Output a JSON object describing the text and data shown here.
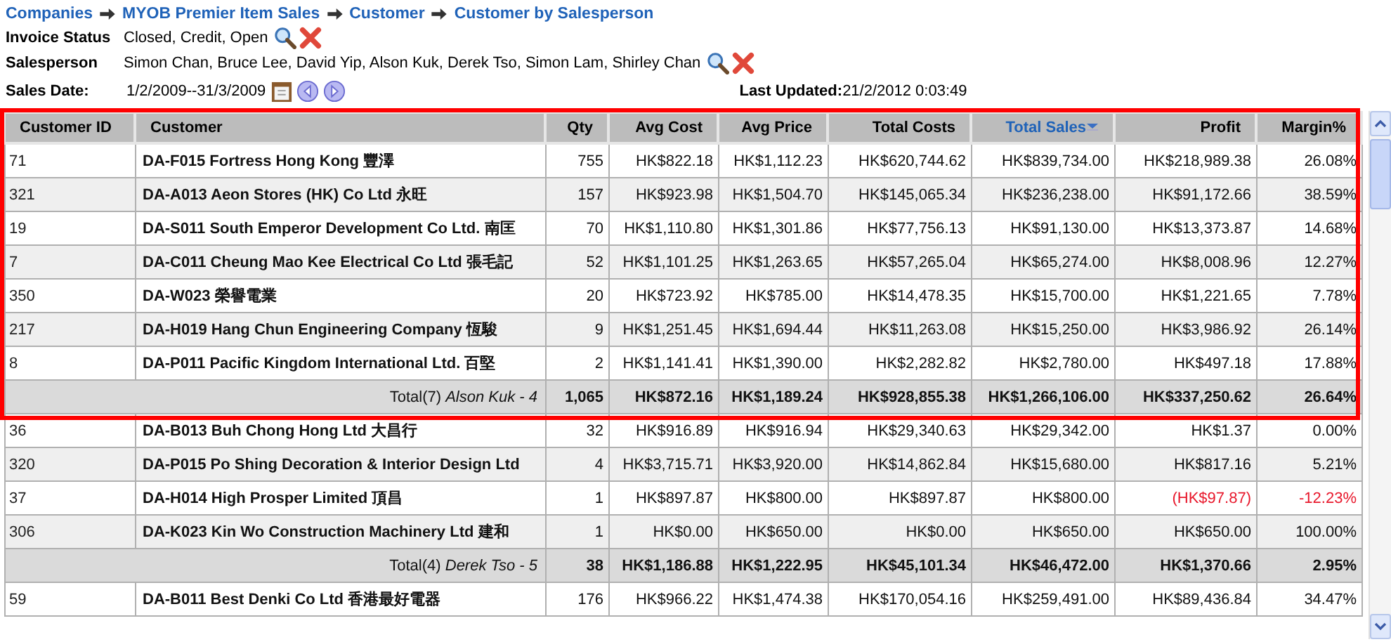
{
  "breadcrumb": [
    "Companies",
    "MYOB Premier Item Sales",
    "Customer",
    "Customer by Salesperson"
  ],
  "filters": [
    {
      "label": "Invoice Status",
      "value": "Closed, Credit, Open"
    },
    {
      "label": "Salesperson",
      "value": "Simon Chan, Bruce Lee, David Yip, Alson Kuk, Derek Tso, Simon Lam, Shirley Chan"
    }
  ],
  "sales_date": {
    "label": "Sales Date:",
    "value": "1/2/2009--31/3/2009"
  },
  "last_updated": {
    "label": "Last Updated:",
    "value": "21/2/2012 0:03:49"
  },
  "table": {
    "columns": [
      {
        "label": "Customer ID",
        "sorted": false
      },
      {
        "label": "Customer",
        "sorted": false
      },
      {
        "label": "Qty",
        "sorted": false
      },
      {
        "label": "Avg Cost",
        "sorted": false
      },
      {
        "label": "Avg Price",
        "sorted": false
      },
      {
        "label": "Total Costs",
        "sorted": false
      },
      {
        "label": "Total Sales",
        "sorted": true
      },
      {
        "label": "Profit",
        "sorted": false
      },
      {
        "label": "Margin%",
        "sorted": false
      }
    ],
    "groups": [
      {
        "highlighted": true,
        "rows": [
          {
            "loss": false,
            "cells": [
              "71",
              "DA-F015 Fortress Hong Kong 豐澤",
              "755",
              "HK$822.18",
              "HK$1,112.23",
              "HK$620,744.62",
              "HK$839,734.00",
              "HK$218,989.38",
              "26.08%"
            ]
          },
          {
            "loss": false,
            "cells": [
              "321",
              "DA-A013 Aeon Stores (HK) Co Ltd 永旺",
              "157",
              "HK$923.98",
              "HK$1,504.70",
              "HK$145,065.34",
              "HK$236,238.00",
              "HK$91,172.66",
              "38.59%"
            ]
          },
          {
            "loss": false,
            "cells": [
              "19",
              "DA-S011 South Emperor Development Co Ltd. 南匡",
              "70",
              "HK$1,110.80",
              "HK$1,301.86",
              "HK$77,756.13",
              "HK$91,130.00",
              "HK$13,373.87",
              "14.68%"
            ]
          },
          {
            "loss": false,
            "cells": [
              "7",
              "DA-C011 Cheung Mao Kee Electrical Co Ltd 張毛記",
              "52",
              "HK$1,101.25",
              "HK$1,263.65",
              "HK$57,265.04",
              "HK$65,274.00",
              "HK$8,008.96",
              "12.27%"
            ]
          },
          {
            "loss": false,
            "cells": [
              "350",
              "DA-W023 榮譽電業",
              "20",
              "HK$723.92",
              "HK$785.00",
              "HK$14,478.35",
              "HK$15,700.00",
              "HK$1,221.65",
              "7.78%"
            ]
          },
          {
            "loss": false,
            "cells": [
              "217",
              "DA-H019 Hang Chun Engineering Company 恆駿",
              "9",
              "HK$1,251.45",
              "HK$1,694.44",
              "HK$11,263.08",
              "HK$15,250.00",
              "HK$3,986.92",
              "26.14%"
            ]
          },
          {
            "loss": false,
            "cells": [
              "8",
              "DA-P011 Pacific Kingdom International Ltd. 百堅",
              "2",
              "HK$1,141.41",
              "HK$1,390.00",
              "HK$2,282.82",
              "HK$2,780.00",
              "HK$497.18",
              "17.88%"
            ]
          }
        ],
        "total": {
          "label": "Total(7) *Alson Kuk - 4*",
          "cells": [
            "1,065",
            "HK$872.16",
            "HK$1,189.24",
            "HK$928,855.38",
            "HK$1,266,106.00",
            "HK$337,250.62",
            "26.64%"
          ]
        }
      },
      {
        "highlighted": false,
        "rows": [
          {
            "loss": false,
            "cells": [
              "36",
              "DA-B013 Buh Chong Hong Ltd 大昌行",
              "32",
              "HK$916.89",
              "HK$916.94",
              "HK$29,340.63",
              "HK$29,342.00",
              "HK$1.37",
              "0.00%"
            ]
          },
          {
            "loss": false,
            "cells": [
              "320",
              "DA-P015 Po Shing Decoration & Interior Design Ltd",
              "4",
              "HK$3,715.71",
              "HK$3,920.00",
              "HK$14,862.84",
              "HK$15,680.00",
              "HK$817.16",
              "5.21%"
            ]
          },
          {
            "loss": true,
            "cells": [
              "37",
              "DA-H014 High Prosper Limited 頂昌",
              "1",
              "HK$897.87",
              "HK$800.00",
              "HK$897.87",
              "HK$800.00",
              "(HK$97.87)",
              "-12.23%"
            ]
          },
          {
            "loss": false,
            "cells": [
              "306",
              "DA-K023 Kin Wo Construction Machinery Ltd 建和",
              "1",
              "HK$0.00",
              "HK$650.00",
              "HK$0.00",
              "HK$650.00",
              "HK$650.00",
              "100.00%"
            ]
          }
        ],
        "total": {
          "label": "Total(4) *Derek Tso - 5*",
          "cells": [
            "38",
            "HK$1,186.88",
            "HK$1,222.95",
            "HK$45,101.34",
            "HK$46,472.00",
            "HK$1,370.66",
            "2.95%"
          ]
        }
      },
      {
        "highlighted": false,
        "rows": [
          {
            "loss": false,
            "cells": [
              "59",
              "DA-B011 Best Denki Co Ltd 香港最好電器",
              "176",
              "HK$966.22",
              "HK$1,474.38",
              "HK$170,054.16",
              "HK$259,491.00",
              "HK$89,436.84",
              "34.47%"
            ]
          }
        ]
      }
    ]
  }
}
